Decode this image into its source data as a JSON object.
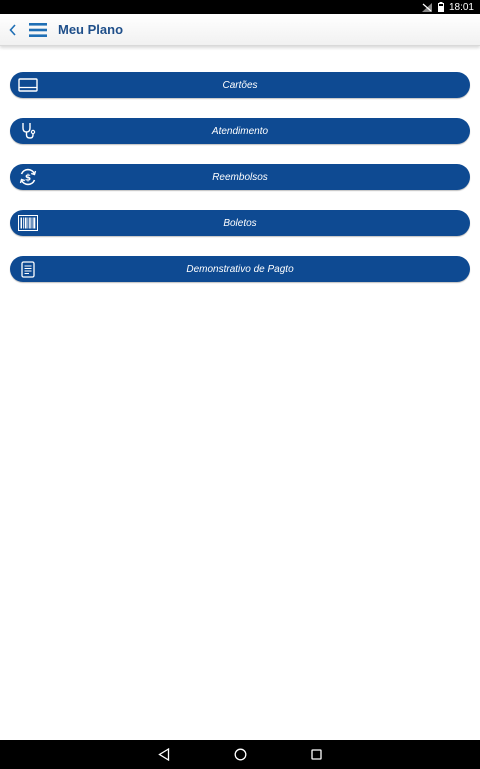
{
  "status_bar": {
    "time": "18:01"
  },
  "app_bar": {
    "title": "Meu Plano"
  },
  "menu": {
    "items": [
      {
        "label": "Cartões",
        "icon": "card-icon"
      },
      {
        "label": "Atendimento",
        "icon": "stethoscope-icon"
      },
      {
        "label": "Reembolsos",
        "icon": "refund-icon"
      },
      {
        "label": "Boletos",
        "icon": "barcode-icon"
      },
      {
        "label": "Demonstrativo de Pagto",
        "icon": "document-icon"
      }
    ]
  },
  "colors": {
    "accent": "#0e4a92",
    "title_text": "#1f4f8a",
    "statusbar": "#000000",
    "navbar": "#000000"
  }
}
